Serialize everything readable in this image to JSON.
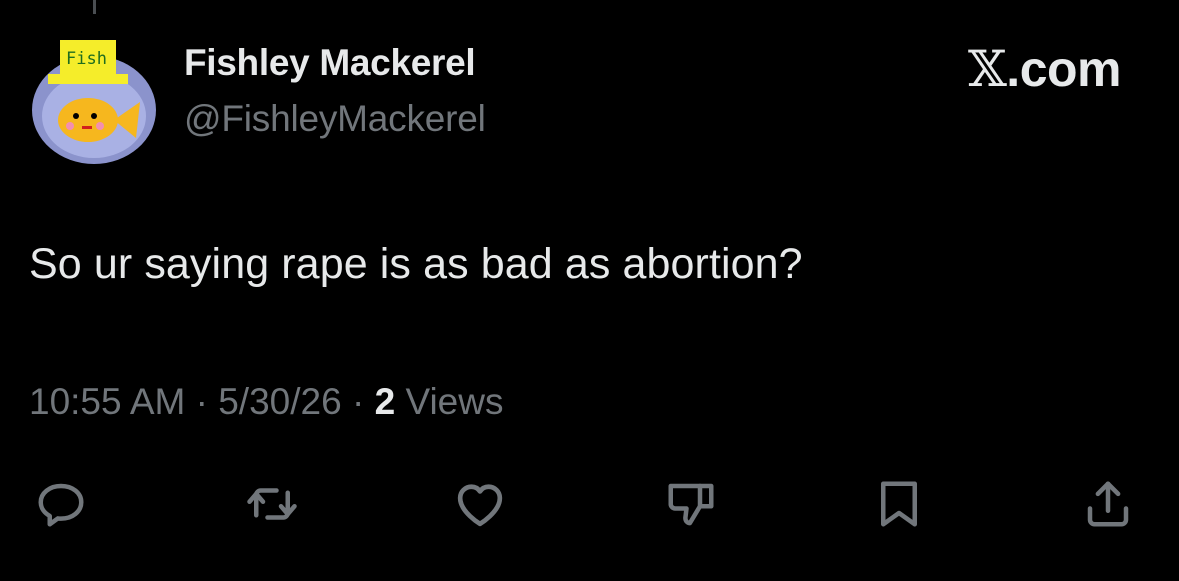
{
  "tweet": {
    "display_name": "Fishley Mackerel",
    "handle": "@FishleyMackerel",
    "avatar_label": "Fish",
    "brand": ".com",
    "brand_mark": "𝕏",
    "text": "So ur saying rape is as bad as abortion?",
    "time": "10:55 AM",
    "date": "5/30/26",
    "separator": "·",
    "views_count": "2",
    "views_label": "Views"
  },
  "actions": [
    {
      "icon": "reply-icon"
    },
    {
      "icon": "retweet-icon"
    },
    {
      "icon": "like-icon"
    },
    {
      "icon": "dislike-icon"
    },
    {
      "icon": "bookmark-icon"
    },
    {
      "icon": "share-icon"
    }
  ],
  "colors": {
    "background": "#000000",
    "primary_text": "#e7e9ea",
    "secondary_text": "#71767b",
    "icon": "#71767b"
  }
}
